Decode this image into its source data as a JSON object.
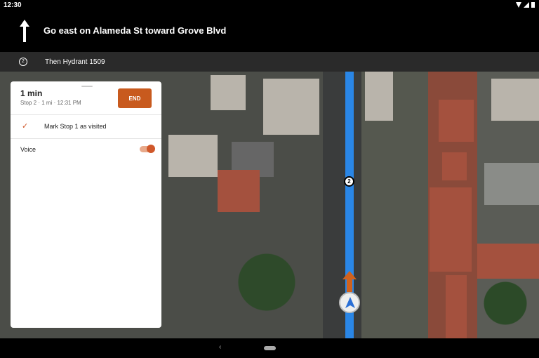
{
  "status": {
    "time": "12:30"
  },
  "nav": {
    "instruction": "Go east on Alameda St toward Grove Blvd",
    "then_number": "2",
    "then_text": "Then Hydrant 1509"
  },
  "map": {
    "stop_marker": "2"
  },
  "card": {
    "eta": "1 min",
    "details": "Stop 2 · 1 mi · 12:31 PM",
    "end_label": "END",
    "mark_visited": "Mark Stop 1 as visited",
    "voice_label": "Voice",
    "voice_on": true
  },
  "colors": {
    "accent": "#c85a1e",
    "route": "#2a86e6"
  }
}
